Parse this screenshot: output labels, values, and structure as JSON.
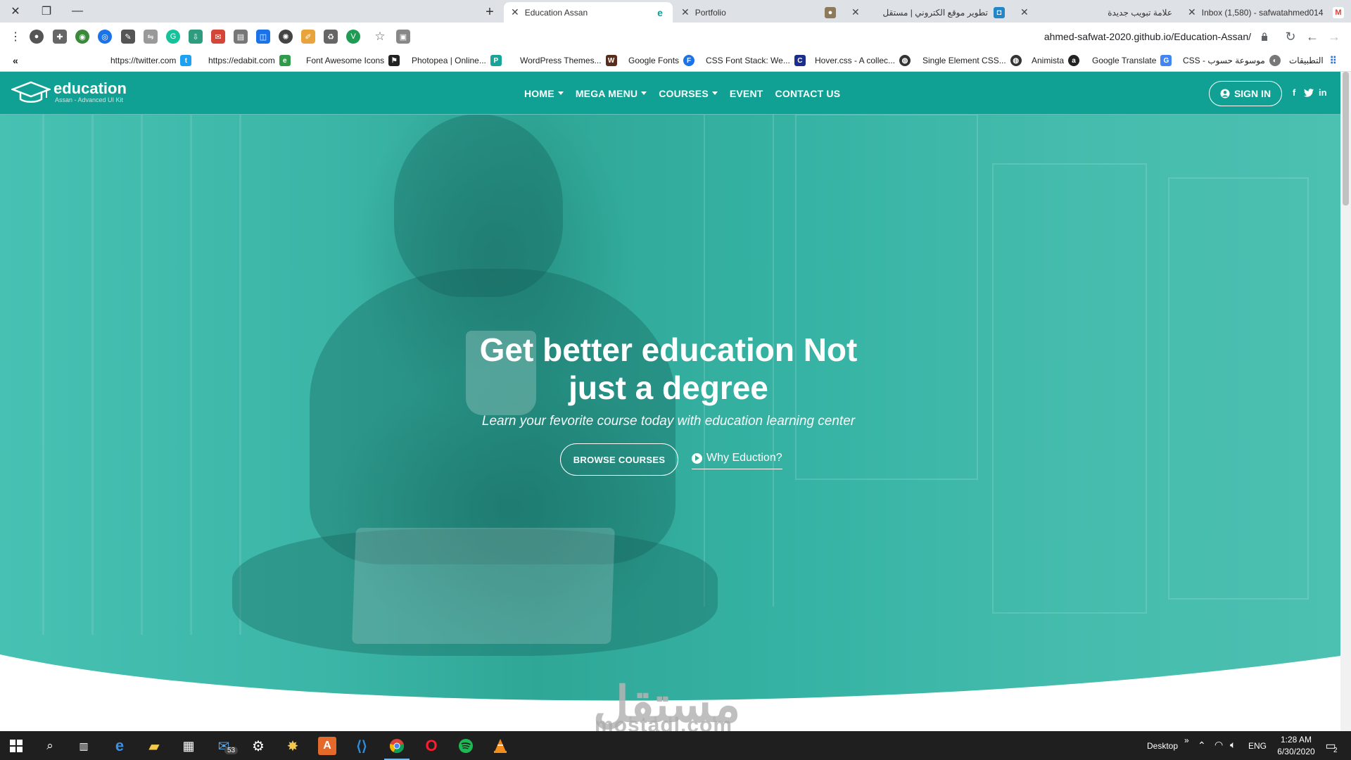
{
  "browser": {
    "tabs": [
      {
        "label": "Inbox (1,580) - safwatahmed014"
      },
      {
        "label": "علامة تبويب جديدة"
      },
      {
        "label": "تطوير موقع الكتروني | مستقل"
      },
      {
        "label": "Portfolio"
      },
      {
        "label": "Education Assan"
      }
    ],
    "url": "ahmed-safwat-2020.github.io/Education-Assan/",
    "bookmarks": [
      {
        "label": "https://twitter.com"
      },
      {
        "label": "https://edabit.com"
      },
      {
        "label": "Font Awesome Icons"
      },
      {
        "label": "Photopea | Online..."
      },
      {
        "label": "WordPress Themes..."
      },
      {
        "label": "Google Fonts"
      },
      {
        "label": "CSS Font Stack: We..."
      },
      {
        "label": "Hover.css - A collec..."
      },
      {
        "label": "Single Element CSS..."
      },
      {
        "label": "Animista"
      },
      {
        "label": "Google Translate"
      },
      {
        "label": "CSS - موسوعة حسوب"
      },
      {
        "label": "التطبيقات"
      }
    ]
  },
  "site": {
    "brand": {
      "name": "education",
      "tagline": "Assan - Advanced UI Kit"
    },
    "menu": [
      {
        "label": "HOME"
      },
      {
        "label": "MEGA MENU"
      },
      {
        "label": "COURSES"
      },
      {
        "label": "EVENT"
      },
      {
        "label": "CONTACT US"
      }
    ],
    "signin": "SIGN IN",
    "social": {
      "facebook": "f",
      "linkedin": "in"
    },
    "hero": {
      "title_line1": "Get better education Not",
      "title_line2": "just a degree",
      "subtitle": "Learn your fevorite course today with education learning center",
      "cta": "BROWSE COURSES",
      "secondary": "Why Eduction?"
    },
    "watermark": "mostaql.com",
    "watermark_logo": "مستقل"
  },
  "taskbar": {
    "mail_badge": "53",
    "desktop_label": "Desktop",
    "lang": "ENG",
    "time": "1:28 AM",
    "date": "6/30/2020",
    "notifications": "2"
  },
  "colors": {
    "nav": "#10a194",
    "hero": "#3bb5a6",
    "taskbar": "#1f1f1f"
  }
}
